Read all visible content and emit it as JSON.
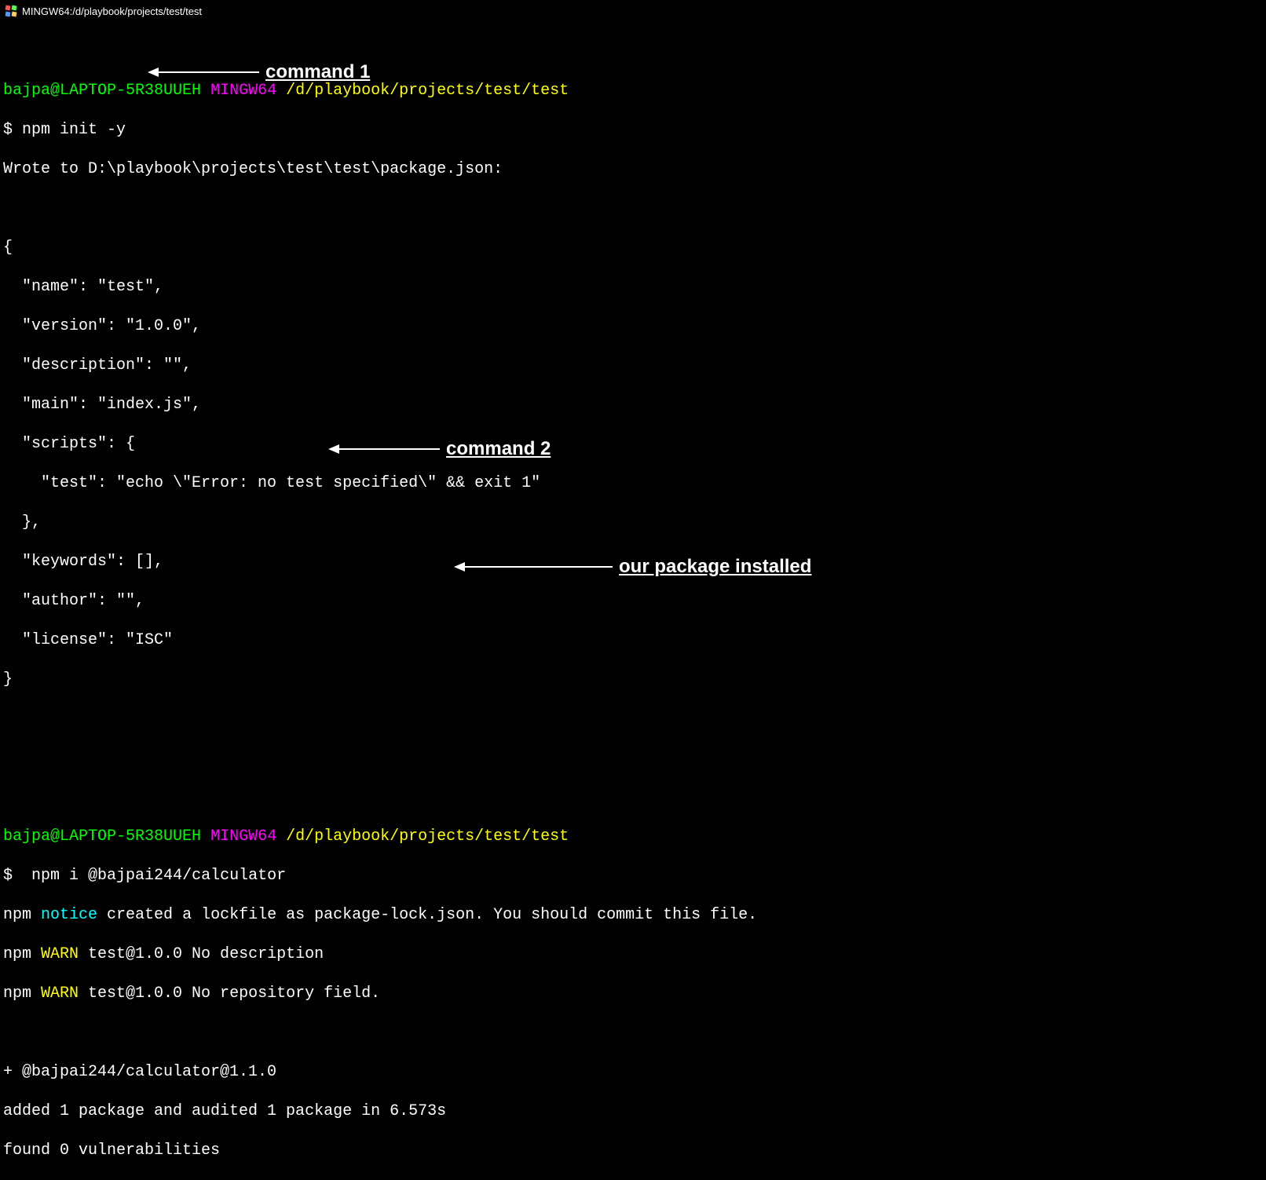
{
  "titlebar": {
    "text": "MINGW64:/d/playbook/projects/test/test"
  },
  "prompt1": {
    "user": "bajpa@LAPTOP-5R38UUEH",
    "shell": "MINGW64",
    "path": "/d/playbook/projects/test/test",
    "symbol": "$",
    "command": "npm init -y"
  },
  "output1": {
    "line1": "Wrote to D:\\playbook\\projects\\test\\test\\package.json:",
    "json_lines": [
      "{",
      "  \"name\": \"test\",",
      "  \"version\": \"1.0.0\",",
      "  \"description\": \"\",",
      "  \"main\": \"index.js\",",
      "  \"scripts\": {",
      "    \"test\": \"echo \\\"Error: no test specified\\\" && exit 1\"",
      "  },",
      "  \"keywords\": [],",
      "  \"author\": \"\",",
      "  \"license\": \"ISC\"",
      "}"
    ]
  },
  "prompt2": {
    "user": "bajpa@LAPTOP-5R38UUEH",
    "shell": "MINGW64",
    "path": "/d/playbook/projects/test/test",
    "symbol": "$",
    "command": " npm i @bajpai244/calculator"
  },
  "output2": {
    "notice_prefix": "npm",
    "notice_word": "notice",
    "notice_text": " created a lockfile as package-lock.json. You should commit this file.",
    "warn1_prefix": "npm ",
    "warn1_word": "WARN",
    "warn1_text": " test@1.0.0 No description",
    "warn2_prefix": "npm ",
    "warn2_word": "WARN",
    "warn2_text": " test@1.0.0 No repository field.",
    "pkg_line": "+ @bajpai244/calculator@1.1.0",
    "added_line": "added 1 package and audited 1 package in 6.573s",
    "vuln_line": "found 0 vulnerabilities"
  },
  "annotations": {
    "a1": "command 1",
    "a2": "command 2",
    "a3": "our package installed"
  }
}
